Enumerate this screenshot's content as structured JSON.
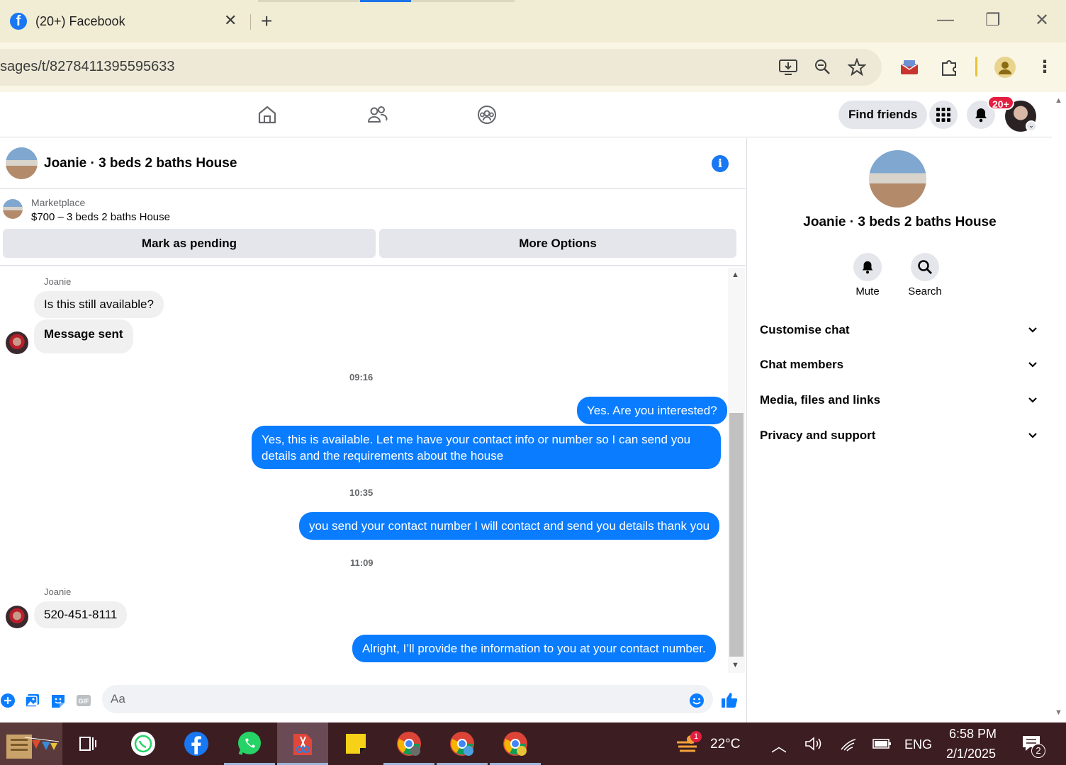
{
  "browser": {
    "tab_title": "(20+) Facebook",
    "url": "sages/t/8278411395595633"
  },
  "fb_header": {
    "find_friends": "Find friends",
    "notification_badge": "20+"
  },
  "conversation": {
    "title": "Joanie · 3 beds 2 baths House",
    "marketplace_label": "Marketplace",
    "listing": "$700 – 3 beds 2 baths House",
    "mark_pending": "Mark as pending",
    "more_options": "More Options"
  },
  "messages": {
    "sender1": "Joanie",
    "m1": "Is this still available?",
    "m2": "Message sent",
    "time1": "09:16",
    "m3": "Yes. Are you interested?",
    "m4": "Yes, this is available. Let me have your contact info or number so I can send you details and the requirements about the house",
    "time2": "10:35",
    "m5": "you send your contact number I will contact  and send you details thank you",
    "time3": "11:09",
    "sender2": "Joanie",
    "m6": "520-451-8111",
    "m7": "Alright, I’ll provide the information to you at your contact number."
  },
  "composer": {
    "placeholder": "Aa"
  },
  "right_panel": {
    "title": "Joanie · 3 beds 2 baths House",
    "mute": "Mute",
    "search": "Search",
    "sections": [
      "Customise chat",
      "Chat members",
      "Media, files and links",
      "Privacy and support"
    ]
  },
  "taskbar": {
    "temperature": "22°C",
    "language": "ENG",
    "time": "6:58 PM",
    "date": "2/1/2025",
    "weather_badge": "1",
    "notif_count": "2"
  },
  "colors": {
    "accent": "#0a7cff",
    "fb_blue": "#1877f2",
    "badge_red": "#e41e3f"
  }
}
